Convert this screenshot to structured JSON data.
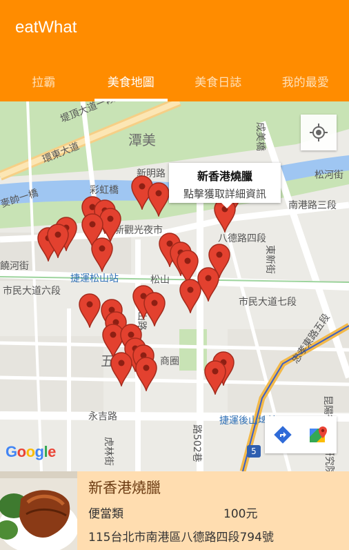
{
  "app": {
    "title": "eatWhat"
  },
  "tabs": [
    {
      "label": "拉霸"
    },
    {
      "label": "美食地圖"
    },
    {
      "label": "美食日誌"
    },
    {
      "label": "我的最愛"
    }
  ],
  "map": {
    "labels": {
      "l1": "堤頂大道一段",
      "l2": "環東大道",
      "l3": "潭美",
      "l4": "新明路",
      "l5": "彩虹橋",
      "l6": "松河街",
      "l7": "南港路三段",
      "l8": "成美橋",
      "l9": "麥帥一橋",
      "l10": "饒河街",
      "l11": "新觀光夜市",
      "l12": "八德路四段",
      "l13": "東新街",
      "l14": "捷運松山站",
      "l15": "松山",
      "l16": "市民大道六段",
      "l17": "市民大道七段",
      "l18": "五",
      "l19": "商圈",
      "l20": "永吉路",
      "l21": "捷運後山埤站",
      "l22": "忠孝東路五段",
      "l23": "虎林街",
      "l24": "松山路",
      "l25": "昆陽街",
      "l26": "研究院路",
      "l27": "路502巷"
    },
    "highway_shield": "5",
    "google_logo": "Google",
    "info_window": {
      "title": "新香港燒臘",
      "subtitle": "點擊獲取詳細資訊"
    }
  },
  "card": {
    "name": "新香港燒臘",
    "category": "便當類",
    "price": "100元",
    "address": "115台北市南港區八德路四段794號"
  }
}
